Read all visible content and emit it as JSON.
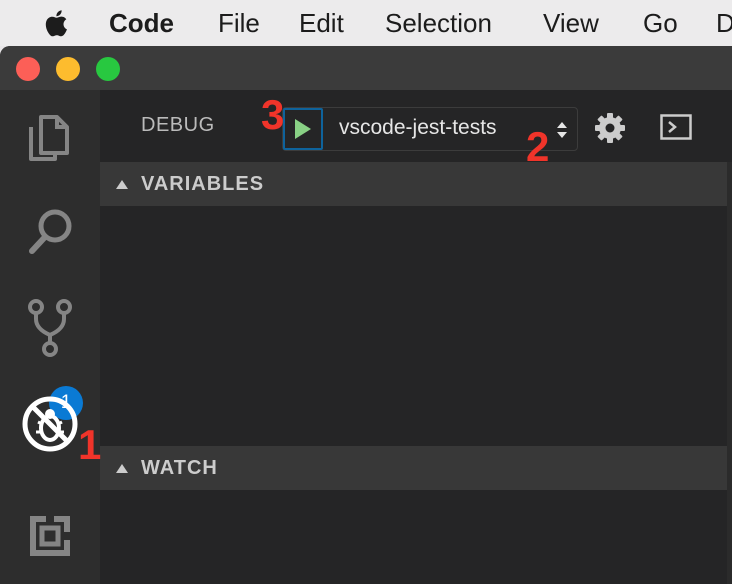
{
  "menubar": {
    "apple_icon": "apple-logo-icon",
    "items": [
      "Code",
      "File",
      "Edit",
      "Selection",
      "View",
      "Go",
      "D"
    ]
  },
  "window": {
    "traffic_lights": {
      "close": "#fc5f57",
      "minimize": "#fdbc2e",
      "zoom": "#28c840"
    }
  },
  "activity_bar": {
    "items": [
      {
        "name": "explorer",
        "icon": "files-icon"
      },
      {
        "name": "search",
        "icon": "search-icon"
      },
      {
        "name": "source-control",
        "icon": "git-branch-icon",
        "badge": "1"
      },
      {
        "name": "debug",
        "icon": "no-bug-icon",
        "active": true
      },
      {
        "name": "extensions",
        "icon": "extensions-icon"
      }
    ]
  },
  "debug_toolbar": {
    "title": "DEBUG",
    "start_icon": "play-icon",
    "configuration": "vscode-jest-tests",
    "settings_icon": "gear-icon",
    "console_icon": "terminal-icon"
  },
  "sections": {
    "variables": "VARIABLES",
    "watch": "WATCH"
  },
  "annotations": {
    "one": "1",
    "two": "2",
    "three": "3"
  },
  "colors": {
    "accent": "#0e639c",
    "badge": "#0a7ad4",
    "play": "#89d185",
    "annotation": "#f0342a"
  }
}
